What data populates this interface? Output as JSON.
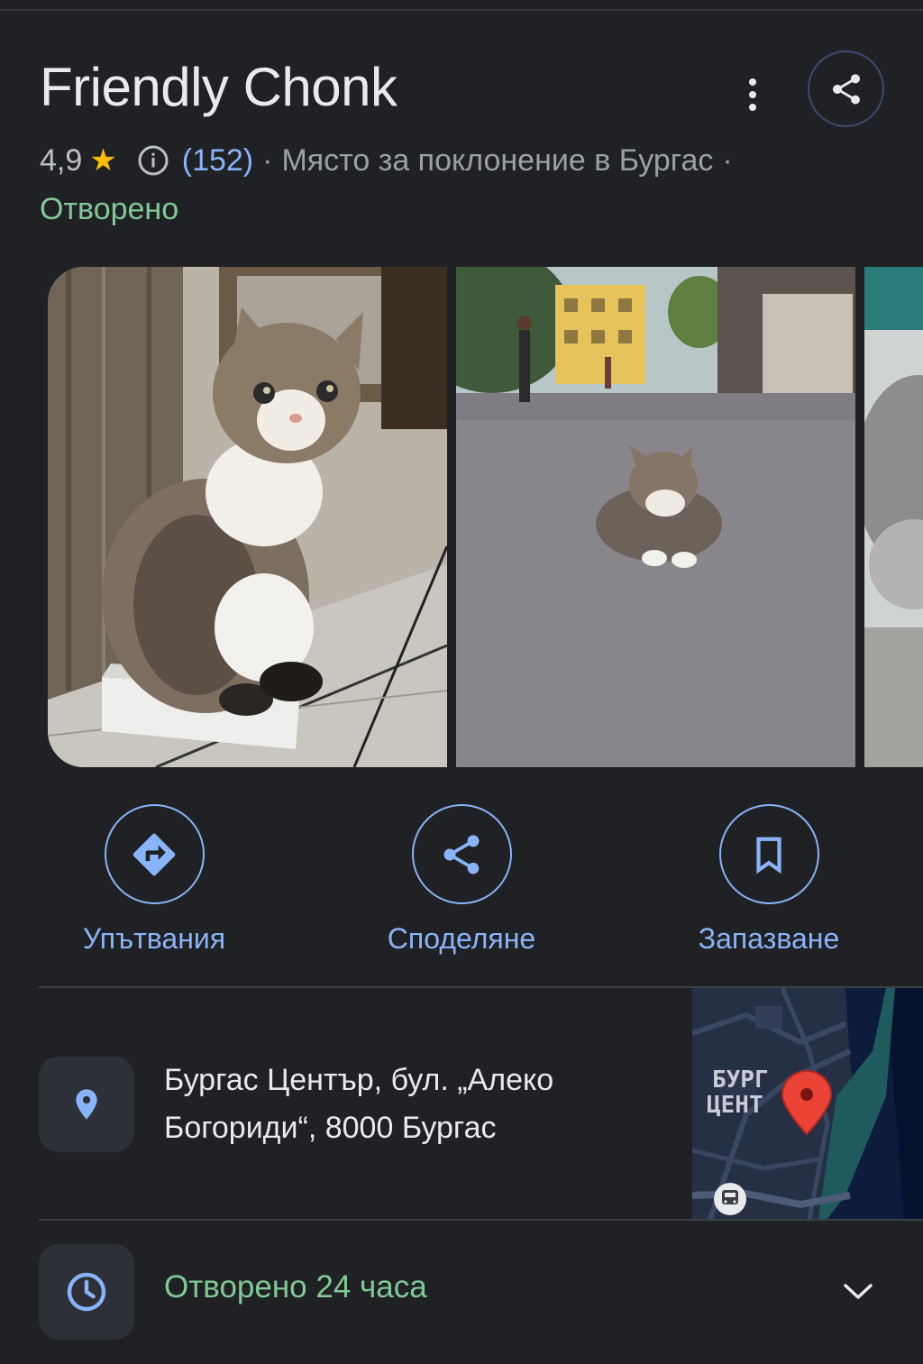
{
  "place": {
    "name": "Friendly Chonk",
    "rating": "4,9",
    "review_count": "(152)",
    "category": "Място за поклонение в Бургас",
    "separator": "·",
    "status": "Отворено"
  },
  "actions": [
    {
      "label": "Упътвания",
      "icon": "directions-icon"
    },
    {
      "label": "Споделяне",
      "icon": "share-icon"
    },
    {
      "label": "Запазване",
      "icon": "bookmark-icon"
    }
  ],
  "address": {
    "line1": "Бургас Център, бул. „Алеко",
    "line2": "Богориди“, 8000 Бургас"
  },
  "map": {
    "label_line1": "БУРГ",
    "label_line2": "ЦЕНТ"
  },
  "hours": {
    "text": "Отворено 24 часа"
  },
  "colors": {
    "background": "#202124",
    "accent": "#8ab4f8",
    "open_green": "#81c995",
    "star": "#fbbc04"
  }
}
